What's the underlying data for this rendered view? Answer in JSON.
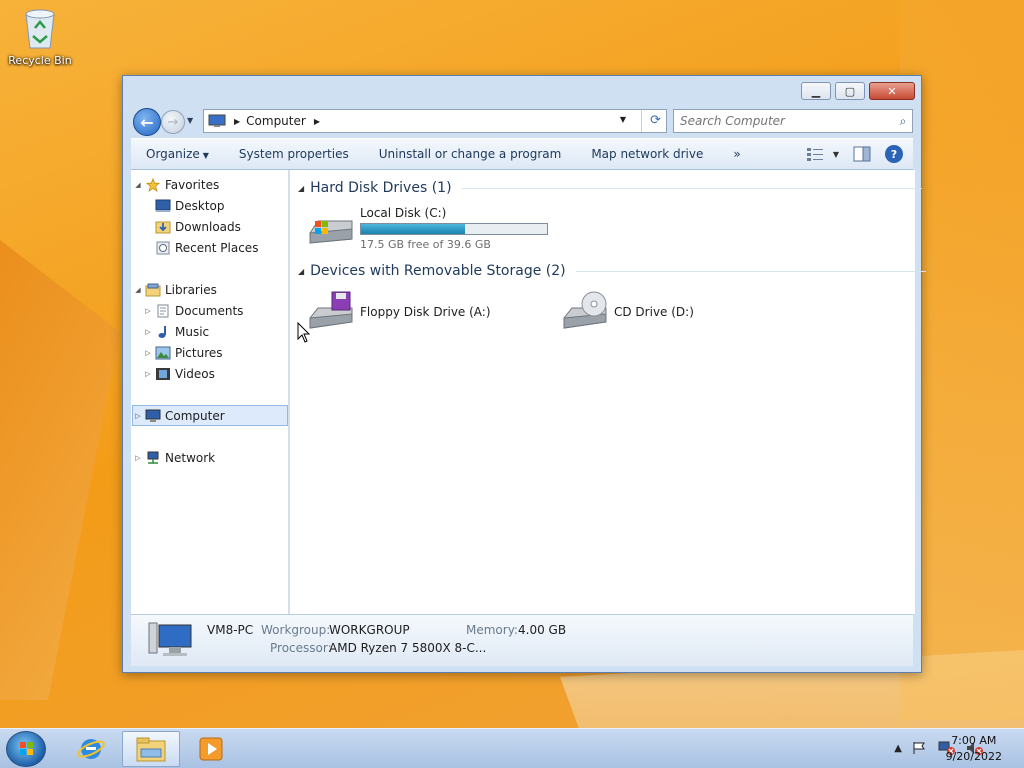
{
  "desktop": {
    "recycle_bin_label": "Recycle Bin"
  },
  "window": {
    "address": {
      "crumb": "Computer"
    },
    "search": {
      "placeholder": "Search Computer"
    },
    "toolbar": {
      "organize": "Organize",
      "system_properties": "System properties",
      "uninstall": "Uninstall or change a program",
      "map_drive": "Map network drive",
      "more": "»"
    },
    "nav": {
      "favorites": "Favorites",
      "desktop": "Desktop",
      "downloads": "Downloads",
      "recent_places": "Recent Places",
      "libraries": "Libraries",
      "documents": "Documents",
      "music": "Music",
      "pictures": "Pictures",
      "videos": "Videos",
      "computer": "Computer",
      "network": "Network"
    },
    "groups": {
      "hdd": {
        "title": "Hard Disk Drives (1)",
        "drives": [
          {
            "name": "Local Disk (C:)",
            "info": "17.5 GB free of 39.6 GB",
            "used_fraction": 0.56
          }
        ]
      },
      "removable": {
        "title": "Devices with Removable Storage (2)",
        "drives": [
          {
            "name": "Floppy Disk Drive (A:)"
          },
          {
            "name": "CD Drive (D:)"
          }
        ]
      }
    },
    "details": {
      "pc_name": "VM8-PC",
      "workgroup_label": "Workgroup:",
      "workgroup": "WORKGROUP",
      "memory_label": "Memory:",
      "memory": "4.00 GB",
      "processor_label": "Processor:",
      "processor": "AMD Ryzen 7 5800X 8-C..."
    }
  },
  "taskbar": {
    "clock_time": "7:00 AM",
    "clock_date": "9/20/2022",
    "tray_arrow": "▲"
  },
  "colors": {
    "accent": "#1e395b",
    "selection": "#dceafb",
    "bar_fill": "#1982b0"
  }
}
